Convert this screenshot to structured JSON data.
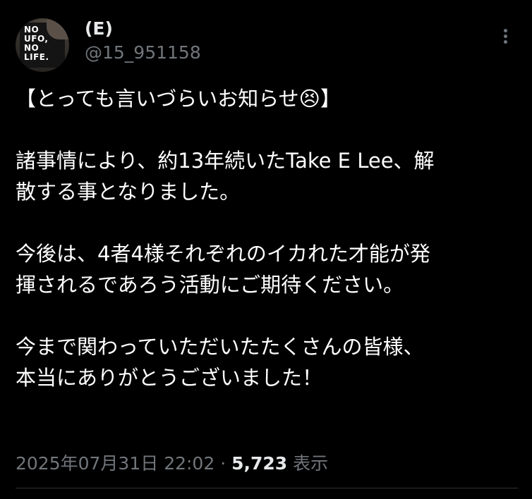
{
  "author": {
    "display_name": "(E)",
    "handle": "@15_951158",
    "avatar": {
      "logo_text": "NO\nUFO,\nNO\nLIFE."
    }
  },
  "more_icon": "more-vertical-icon",
  "tweet": {
    "paragraphs": [
      "【とっても言いづらいお知らせ😣】",
      "諸事情により、約13年続いたTake E Lee、解\n散する事となりました。",
      "今後は、4者4様それぞれのイカれた才能が発\n揮されるであろう活動にご期待ください。",
      "今まで関わっていただいたたくさんの皆様、\n本当にありがとうございました！"
    ]
  },
  "meta": {
    "timestamp": "2025年07月31日 22:02",
    "separator": " · ",
    "views_count": "5,723",
    "views_label": " 表示"
  },
  "colors": {
    "background": "#000000",
    "primary_text": "#e7e9ea",
    "secondary_text": "#71767b",
    "divider": "#2f3336"
  }
}
